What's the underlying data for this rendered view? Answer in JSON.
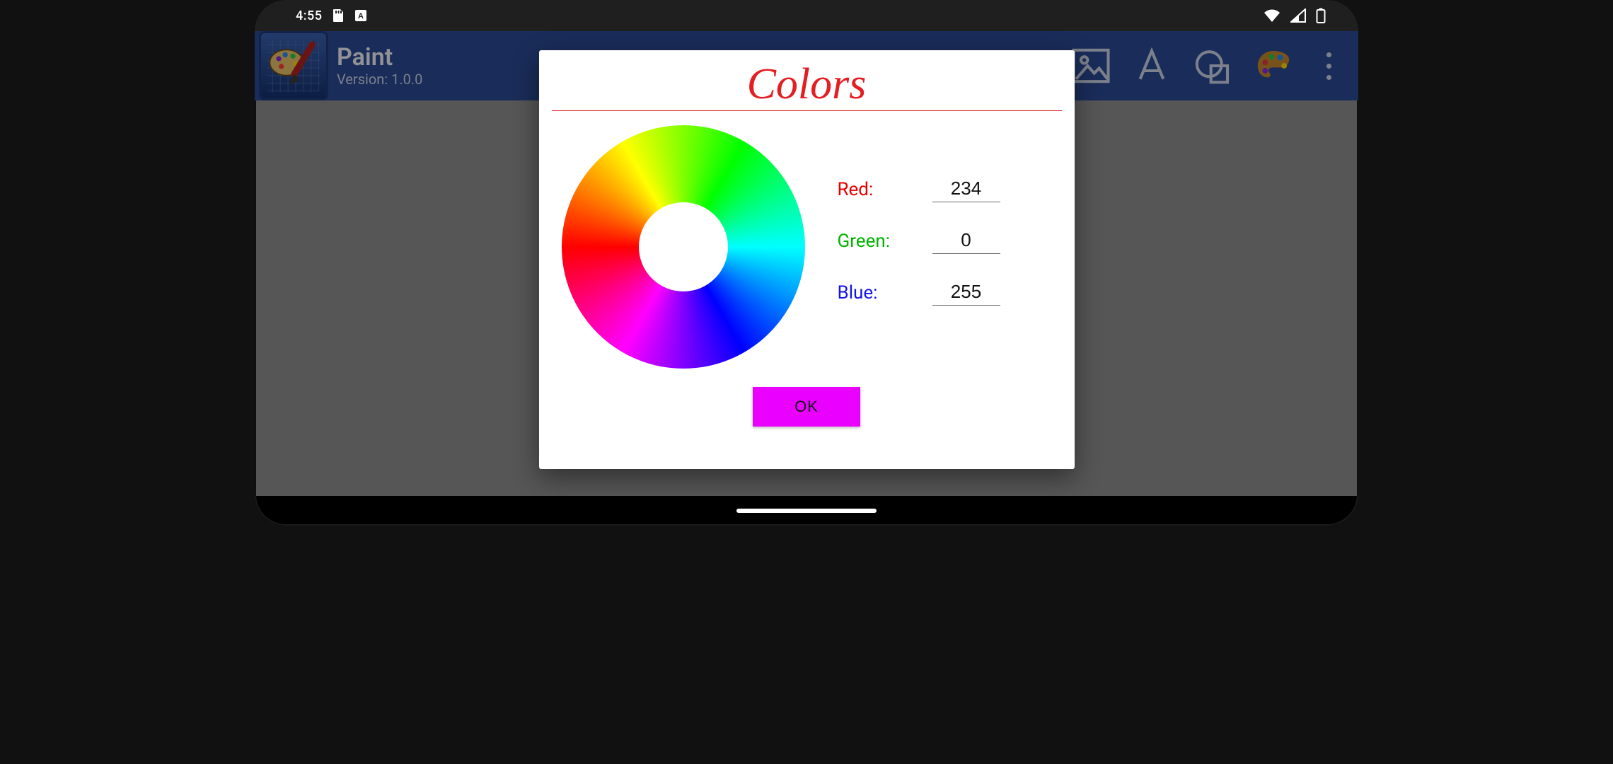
{
  "status": {
    "clock": "4:55"
  },
  "app": {
    "title": "Paint",
    "version": "Version: 1.0.0"
  },
  "dialog": {
    "title": "Colors",
    "labels": {
      "red": "Red:",
      "green": "Green:",
      "blue": "Blue:"
    },
    "values": {
      "red": "234",
      "green": "0",
      "blue": "255"
    },
    "ok": "OK",
    "ok_color": "#ea00ff"
  }
}
